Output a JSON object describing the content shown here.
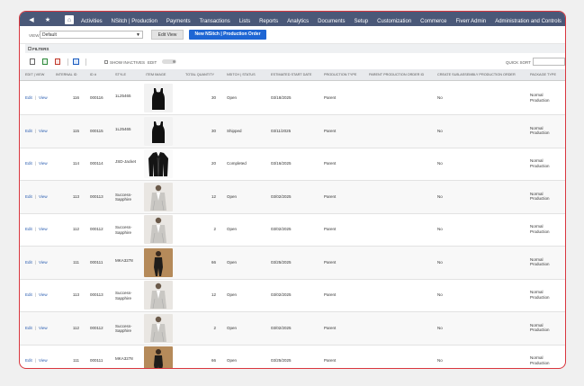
{
  "nav": {
    "menu": [
      "Activities",
      "NSitch | Production",
      "Payments",
      "Transactions",
      "Lists",
      "Reports",
      "Analytics",
      "Documents",
      "Setup",
      "Customization",
      "Commerce",
      "Fiverr Admin",
      "Administration and Controls"
    ]
  },
  "view": {
    "label": "VIEW",
    "selected": "Default",
    "edit_view_label": "Edit View",
    "new_button_label": "New NSitch | Production Order"
  },
  "filters": {
    "label": "FILTERS"
  },
  "toolbar": {
    "show_inactives_label": "SHOW INACTIVES",
    "edit_label": "EDIT",
    "quick_sort_label": "QUICK SORT"
  },
  "columns": {
    "edit_view": "EDIT | VIEW",
    "internal_id": "INTERNAL ID",
    "id": "ID #",
    "style": "STYLE",
    "item_image": "ITEM IMAGE",
    "total_quantity": "TOTAL QUANTITY",
    "status": "NSITCH | STATUS",
    "start_date": "ESTIMATED START DATE",
    "production_type": "PRODUCTION TYPE",
    "parent_order": "PARENT PRODUCTION ORDER ID",
    "create_sub": "CREATE SUB-ASSEMBLY PRODUCTION ORDER",
    "package_type": "PACKAGE TYPE"
  },
  "rows": [
    {
      "edit": "Edit",
      "view": "View",
      "internal_id": "116",
      "id": "000116",
      "style": "1L25465",
      "image": "tank",
      "qty": "30",
      "status": "Open",
      "date": "03/18/2025",
      "ptype": "Parent",
      "parent": "",
      "sub": "No",
      "package": "Normal Production"
    },
    {
      "edit": "Edit",
      "view": "View",
      "internal_id": "115",
      "id": "000115",
      "style": "1L25465",
      "image": "tank",
      "qty": "30",
      "status": "Shipped",
      "date": "03/11/2025",
      "ptype": "Parent",
      "parent": "",
      "sub": "No",
      "package": "Normal Production"
    },
    {
      "edit": "Edit",
      "view": "View",
      "internal_id": "114",
      "id": "000114",
      "style": "JSD-Jacket",
      "image": "jacket",
      "qty": "20",
      "status": "Completed",
      "date": "03/16/2025",
      "ptype": "Parent",
      "parent": "",
      "sub": "No",
      "package": "Normal Production"
    },
    {
      "edit": "Edit",
      "view": "View",
      "internal_id": "113",
      "id": "000113",
      "style": "Success-Sapphire",
      "image": "suit",
      "qty": "12",
      "status": "Open",
      "date": "03/02/2025",
      "ptype": "Parent",
      "parent": "",
      "sub": "No",
      "package": "Normal Production"
    },
    {
      "edit": "Edit",
      "view": "View",
      "internal_id": "112",
      "id": "000112",
      "style": "Success-Sapphire",
      "image": "suit",
      "qty": "2",
      "status": "Open",
      "date": "03/02/2025",
      "ptype": "Parent",
      "parent": "",
      "sub": "No",
      "package": "Normal Production"
    },
    {
      "edit": "Edit",
      "view": "View",
      "internal_id": "111",
      "id": "000111",
      "style": "MKA3278",
      "image": "model",
      "qty": "66",
      "status": "Open",
      "date": "03/25/2025",
      "ptype": "Parent",
      "parent": "",
      "sub": "No",
      "package": "Normal Production"
    },
    {
      "edit": "Edit",
      "view": "View",
      "internal_id": "113",
      "id": "000113",
      "style": "Success-Sapphire",
      "image": "suit",
      "qty": "12",
      "status": "Open",
      "date": "03/02/2025",
      "ptype": "Parent",
      "parent": "",
      "sub": "No",
      "package": "Normal Production"
    },
    {
      "edit": "Edit",
      "view": "View",
      "internal_id": "112",
      "id": "000112",
      "style": "Success-Sapphire",
      "image": "suit",
      "qty": "2",
      "status": "Open",
      "date": "03/02/2025",
      "ptype": "Parent",
      "parent": "",
      "sub": "No",
      "package": "Normal Production"
    },
    {
      "edit": "Edit",
      "view": "View",
      "internal_id": "111",
      "id": "000111",
      "style": "MKA3278",
      "image": "model",
      "qty": "66",
      "status": "Open",
      "date": "03/25/2025",
      "ptype": "Parent",
      "parent": "",
      "sub": "No",
      "package": "Normal Production"
    }
  ],
  "colors": {
    "nav": "#4a5878",
    "primary": "#1e66d4",
    "frame": "#d9363e",
    "link": "#2a5db0"
  }
}
